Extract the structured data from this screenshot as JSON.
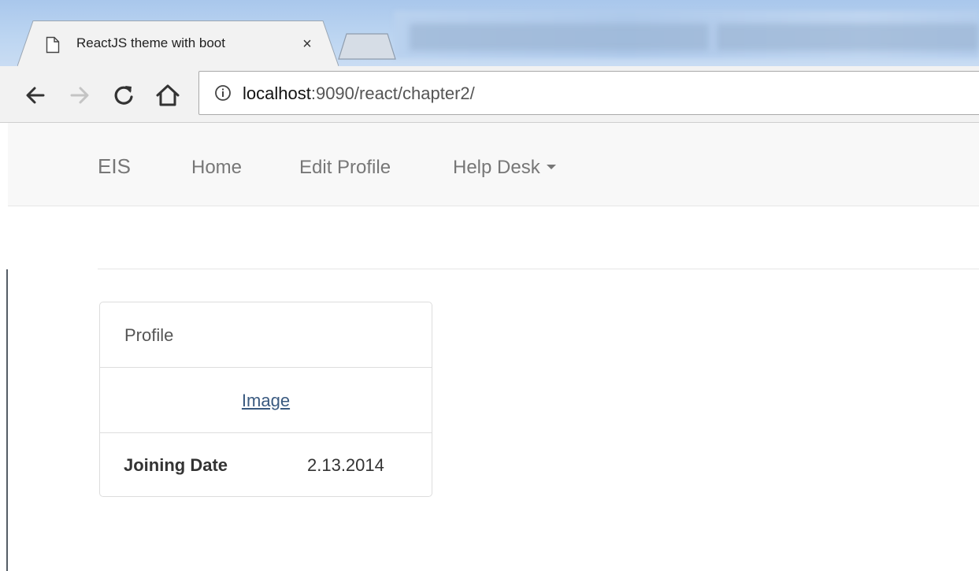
{
  "browser": {
    "tab_title": "ReactJS theme with boot",
    "tab_close": "×",
    "url_host": "localhost",
    "url_path": ":9090/react/chapter2/"
  },
  "navbar": {
    "brand": "EIS",
    "items": [
      {
        "label": "Home"
      },
      {
        "label": "Edit Profile"
      },
      {
        "label": "Help Desk"
      }
    ]
  },
  "profile_panel": {
    "heading": "Profile",
    "image_link": "Image",
    "joining_date_label": "Joining Date",
    "joining_date_value": "2.13.2014"
  },
  "icons": {
    "tab": "page-icon",
    "close": "close-icon",
    "back": "back-arrow-icon",
    "forward": "forward-arrow-icon",
    "reload": "reload-icon",
    "home": "home-icon",
    "info": "info-icon",
    "dropdown": "caret-down-icon"
  }
}
